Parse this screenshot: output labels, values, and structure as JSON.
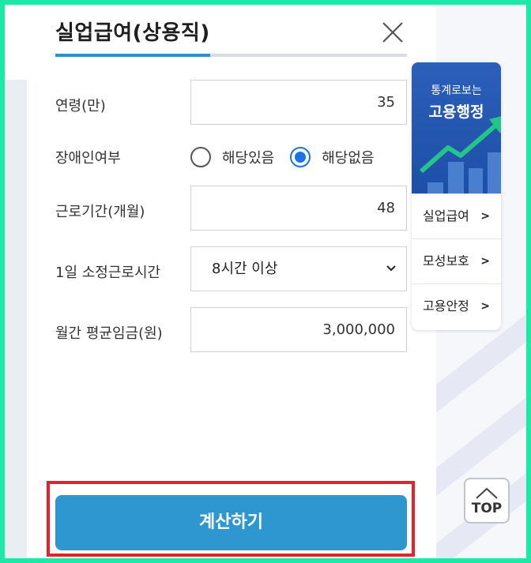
{
  "modal": {
    "title": "실업급여(상용직)",
    "progress": 0.44
  },
  "form": {
    "age": {
      "label": "연령(만)",
      "value": "35"
    },
    "disability": {
      "label": "장애인여부",
      "options": [
        {
          "label": "해당있음",
          "checked": false
        },
        {
          "label": "해당없음",
          "checked": true
        }
      ]
    },
    "work_period": {
      "label": "근로기간(개월)",
      "value": "48"
    },
    "daily_hours": {
      "label": "1일 소정근로시간",
      "selected": "8시간 이상"
    },
    "monthly_wage": {
      "label": "월간 평균임금(원)",
      "value": "3,000,000"
    }
  },
  "actions": {
    "calculate_label": "계산하기"
  },
  "side_widget": {
    "banner_line1": "통계로보는",
    "banner_line2": "고용행정",
    "items": [
      {
        "label": "실업급여"
      },
      {
        "label": "모성보호"
      },
      {
        "label": "고용안정"
      }
    ]
  },
  "top_button": {
    "label": "TOP"
  },
  "colors": {
    "accent": "#2e97d0",
    "frame": "#1ee8a6",
    "highlight": "#e8202a",
    "radio": "#1a73e8",
    "banner": "#1e4fa8"
  }
}
